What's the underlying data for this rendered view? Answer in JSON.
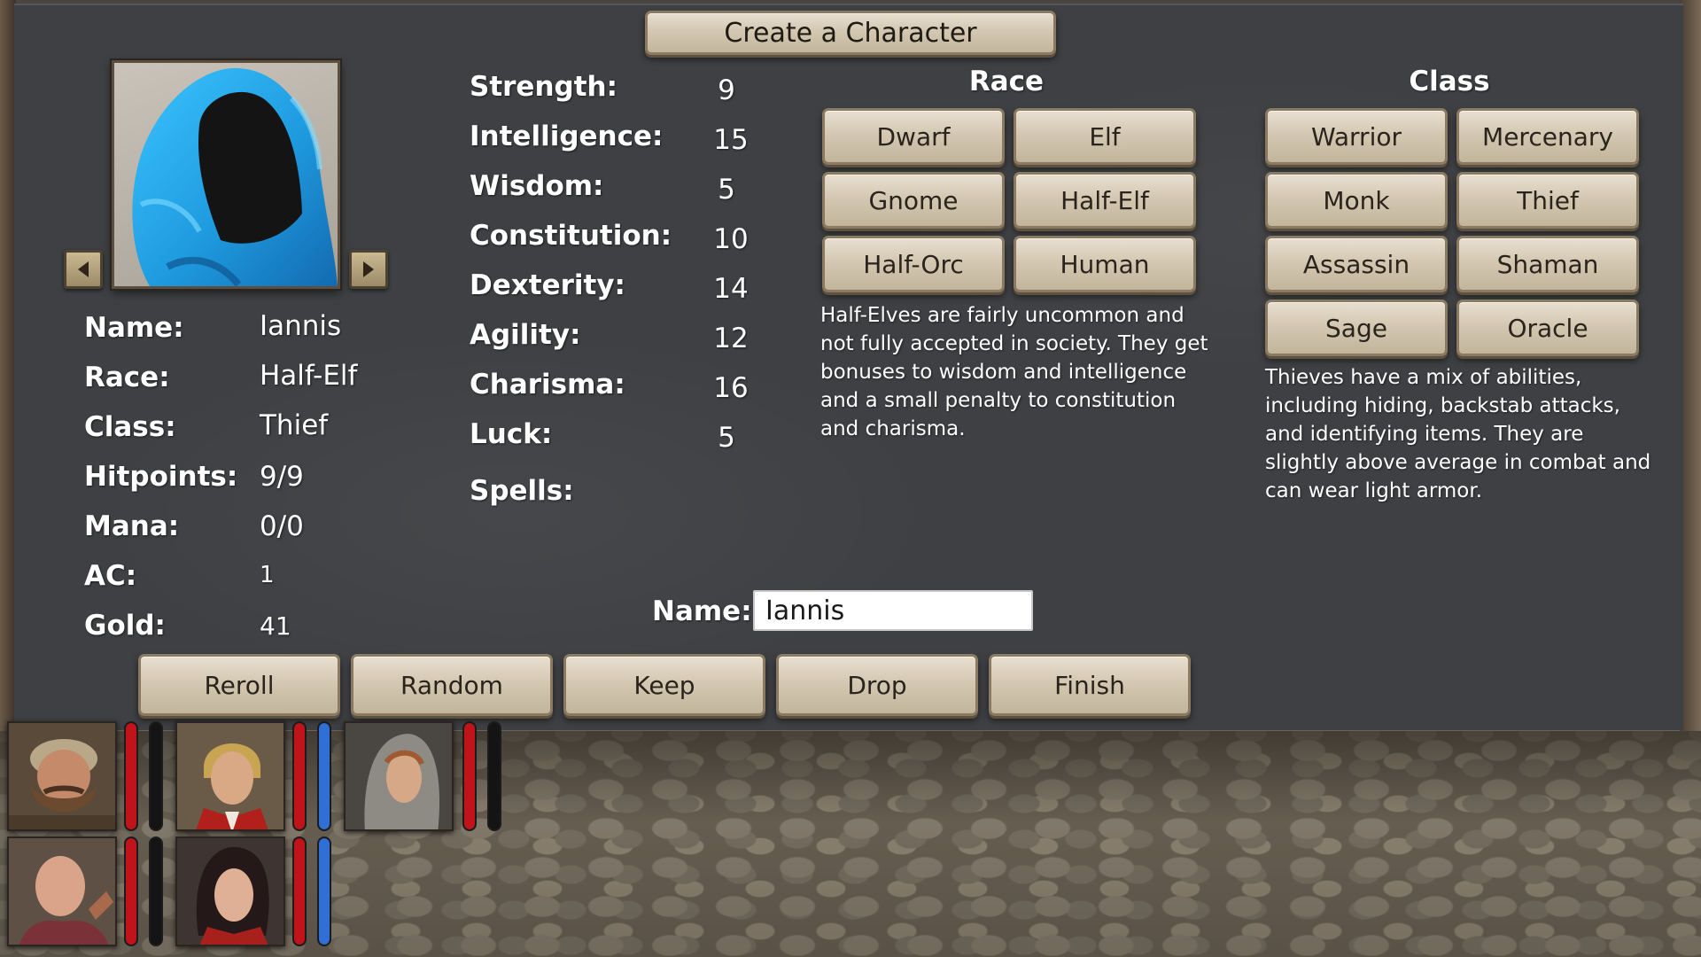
{
  "window": {
    "title": "Create a Character"
  },
  "colors": {
    "hp_bar": "#c0141a",
    "mana_bar": "#2f6fd6",
    "panel_bg": "#3e4043",
    "button_parchment": "#d4c8b2",
    "portrait_hood": "#2aa7ea"
  },
  "portrait": {
    "icon": "blue-hooded-figure-portrait",
    "prev_icon": "arrow-left-icon",
    "next_icon": "arrow-right-icon"
  },
  "info": {
    "name_label": "Name:",
    "name_value": "Iannis",
    "race_label": "Race:",
    "race_value": "Half-Elf",
    "class_label": "Class:",
    "class_value": "Thief",
    "hitpoints_label": "Hitpoints:",
    "hitpoints_value": "9/9",
    "mana_label": "Mana:",
    "mana_value": "0/0",
    "ac_label": "AC:",
    "ac_value": "1",
    "gold_label": "Gold:",
    "gold_value": "41"
  },
  "stats": [
    {
      "label": "Strength:",
      "value": "9"
    },
    {
      "label": "Intelligence:",
      "value": "15"
    },
    {
      "label": "Wisdom:",
      "value": "5"
    },
    {
      "label": "Constitution:",
      "value": "10"
    },
    {
      "label": "Dexterity:",
      "value": "14"
    },
    {
      "label": "Agility:",
      "value": "12"
    },
    {
      "label": "Charisma:",
      "value": "16"
    },
    {
      "label": "Luck:",
      "value": "5"
    }
  ],
  "spells_label": "Spells:",
  "race": {
    "heading": "Race",
    "options": [
      "Dwarf",
      "Elf",
      "Gnome",
      "Half-Elf",
      "Half-Orc",
      "Human"
    ],
    "selected": "Half-Elf",
    "description": "Half-Elves are fairly uncommon and not fully accepted in society. They get bonuses to wisdom and intelligence and a small penalty to constitution and charisma."
  },
  "class": {
    "heading": "Class",
    "options": [
      "Warrior",
      "Mercenary",
      "Monk",
      "Thief",
      "Assassin",
      "Shaman",
      "Sage",
      "Oracle"
    ],
    "selected": "Thief",
    "description": "Thieves have a mix of abilities, including hiding, backstab attacks, and identifying items. They are slightly above average in combat and can wear light armor."
  },
  "name_field": {
    "label": "Name:",
    "value": "Iannis"
  },
  "actions": [
    "Reroll",
    "Random",
    "Keep",
    "Drop",
    "Finish"
  ],
  "party": [
    {
      "icon": "dwarf-portrait",
      "hp": 1.0,
      "mana": 0.0
    },
    {
      "icon": "blonde-man-portrait",
      "hp": 1.0,
      "mana": 1.0
    },
    {
      "icon": "hooded-woman-portrait",
      "hp": 1.0,
      "mana": 0.0
    },
    {
      "icon": "bald-man-portrait",
      "hp": 1.0,
      "mana": 0.0
    },
    {
      "icon": "dark-haired-woman-portrait",
      "hp": 1.0,
      "mana": 1.0
    }
  ]
}
